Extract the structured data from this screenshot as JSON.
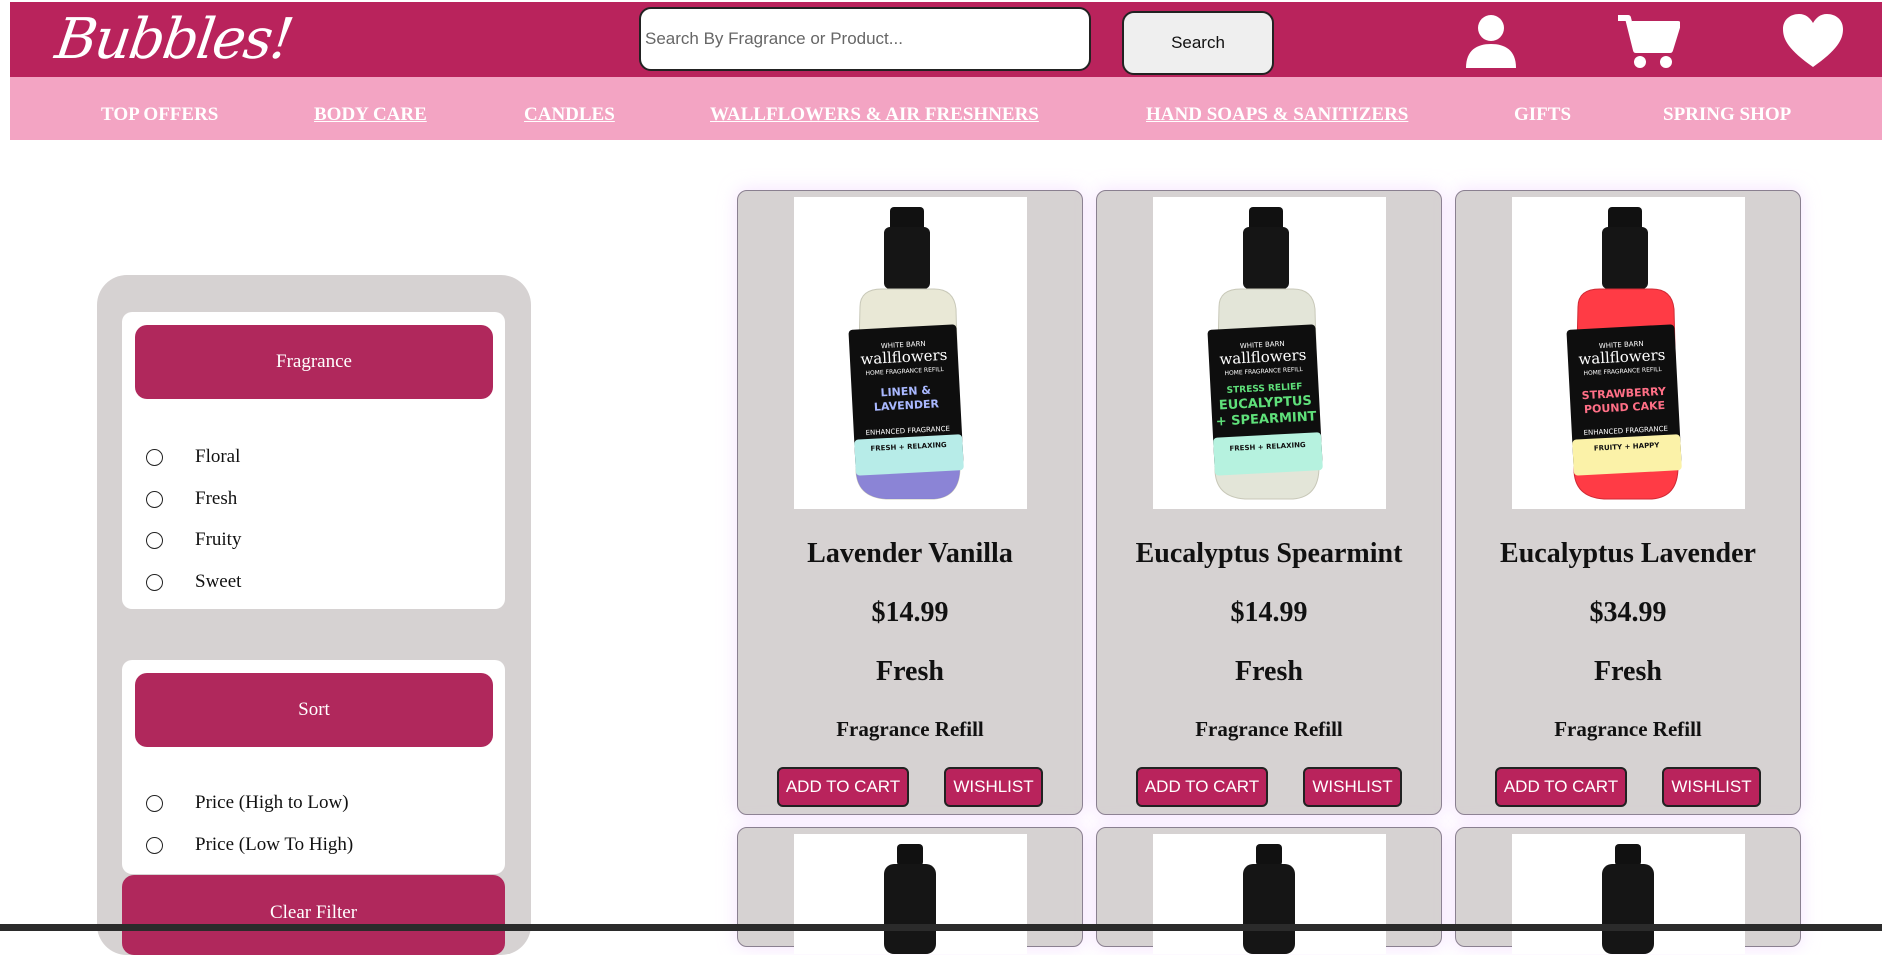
{
  "header": {
    "logo_text": "Bubbles!",
    "search_placeholder": "Search By Fragrance or Product...",
    "search_button_label": "Search",
    "icons": [
      "user-icon",
      "cart-icon",
      "heart-icon"
    ]
  },
  "nav": {
    "links": [
      {
        "label": "TOP OFFERS",
        "underlined": false
      },
      {
        "label": "BODY CARE",
        "underlined": true
      },
      {
        "label": "CANDLES",
        "underlined": true
      },
      {
        "label": "WALLFLOWERS & AIR FRESHNERS",
        "underlined": true
      },
      {
        "label": "HAND SOAPS & SANITIZERS",
        "underlined": true
      },
      {
        "label": "GIFTS",
        "underlined": false
      },
      {
        "label": "SPRING SHOP",
        "underlined": false
      }
    ]
  },
  "filters": {
    "fragrance": {
      "title": "Fragrance",
      "options": [
        "Floral",
        "Fresh",
        "Fruity",
        "Sweet"
      ]
    },
    "sort": {
      "title": "Sort",
      "options": [
        "Price (High to Low)",
        "Price (Low To High)"
      ]
    },
    "clear_label": "Clear Filter"
  },
  "products": [
    {
      "name": "Lavender Vanilla",
      "price": "$14.99",
      "type": "Fresh",
      "category": "Fragrance Refill",
      "add_label": "ADD TO CART",
      "wish_label": "WISHLIST",
      "image": {
        "brand": "WHITE BARN",
        "line": "wallflowers",
        "sub": "HOME FRAGRANCE REFILL",
        "scent_1": "LINEN &",
        "scent_2": "LAVENDER",
        "tag": "FRESH + RELAXING",
        "label_color": "#b7ece8",
        "liquid_color": "#7a72d6",
        "text_color": "#a9b8ff"
      }
    },
    {
      "name": "Eucalyptus Spearmint",
      "price": "$14.99",
      "type": "Fresh",
      "category": "Fragrance Refill",
      "add_label": "ADD TO CART",
      "wish_label": "WISHLIST",
      "image": {
        "brand": "WHITE BARN",
        "line": "wallflowers",
        "sub": "HOME FRAGRANCE REFILL",
        "scent_1": "STRESS RELIEF",
        "scent_2": "EUCALYPTUS",
        "scent_3": "+ SPEARMINT",
        "tag": "FRESH + RELAXING",
        "label_color": "#b6f2df",
        "liquid_color": "#d9ddd0",
        "text_color": "#5fe07a"
      }
    },
    {
      "name": "Eucalyptus Lavender",
      "price": "$34.99",
      "type": "Fresh",
      "category": "Fragrance Refill",
      "add_label": "ADD TO CART",
      "wish_label": "WISHLIST",
      "image": {
        "brand": "WHITE BARN",
        "line": "wallflowers",
        "sub": "HOME FRAGRANCE REFILL",
        "scent_1": "STRAWBERRY",
        "scent_2": "POUND CAKE",
        "tag": "FRUITY + HAPPY",
        "label_color": "#fbf2a8",
        "liquid_color": "#ff3b45",
        "text_color": "#ff6f86"
      }
    }
  ],
  "colors": {
    "brand": "#b9235c",
    "nav_pink": "#f3a4c3",
    "filter_button": "#b0285c",
    "card_bg": "#d6d2d2"
  }
}
